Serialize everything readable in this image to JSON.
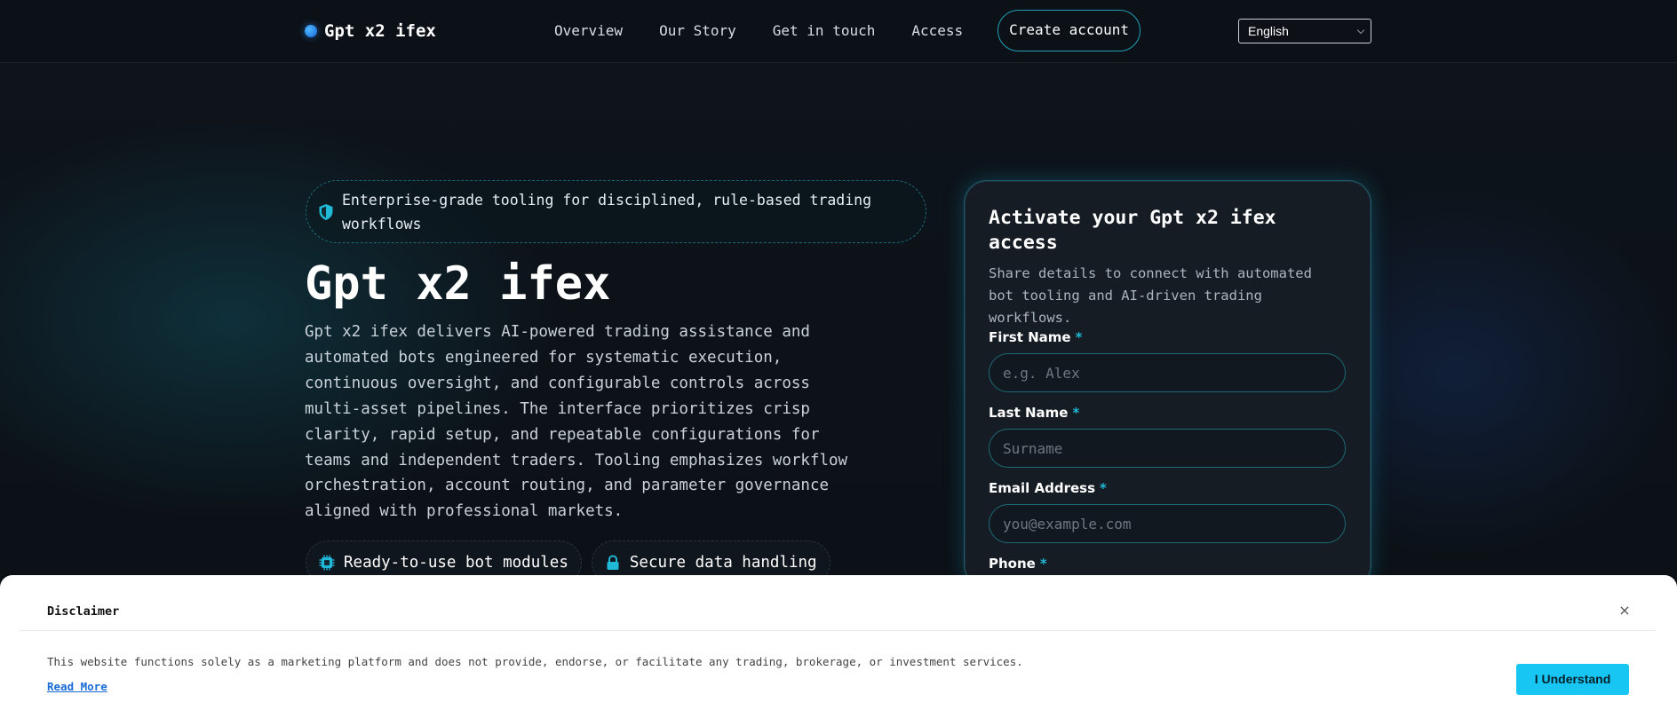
{
  "header": {
    "brand": "Gpt x2 ifex",
    "nav": [
      "Overview",
      "Our Story",
      "Get in touch",
      "Access"
    ],
    "cta": "Create account",
    "language": "English"
  },
  "hero": {
    "badge": "Enterprise-grade tooling for disciplined, rule-based trading workflows",
    "title": "Gpt x2 ifex",
    "description": "Gpt x2 ifex delivers AI-powered trading assistance and auto­mated bots engineered for systematic execution, continuous oversight, and configurable controls across multi-asset pipe­lines. The interface prioritizes crisp clarity, rapid setup, and repeatable configurations for teams and independent traders. Tooling emphasizes workflow orchestration, account routing, and parameter governance aligned with professional markets.",
    "features": [
      "Ready-to-use bot modules",
      "Secure data handling"
    ]
  },
  "form": {
    "title": "Activate your Gpt x2 ifex access",
    "subtitle": "Share details to connect with automated bot tooling and AI-driven trading workflows.",
    "required_mark": "*",
    "fields": [
      {
        "label": "First Name",
        "placeholder": "e.g. Alex"
      },
      {
        "label": "Last Name",
        "placeholder": "Surname"
      },
      {
        "label": "Email Address",
        "placeholder": "you@example.com"
      },
      {
        "label": "Phone",
        "placeholder": ""
      }
    ]
  },
  "disclaimer": {
    "title": "Disclaimer",
    "text": "This website functions solely as a marketing platform and does not provide, endorse, or facilitate any trading, brokerage, or investment services.",
    "link": "Read More",
    "button": "I Understand",
    "close": "×"
  },
  "icons": {
    "brand": "brand-dot-icon",
    "badge": "shield-icon",
    "feature_1": "chip-icon",
    "feature_2": "lock-icon",
    "close": "close-icon"
  },
  "colors": {
    "accent": "#1fb8d6",
    "button": "#18c6f3",
    "background": "#0d1117",
    "link": "#1a6bd6"
  }
}
